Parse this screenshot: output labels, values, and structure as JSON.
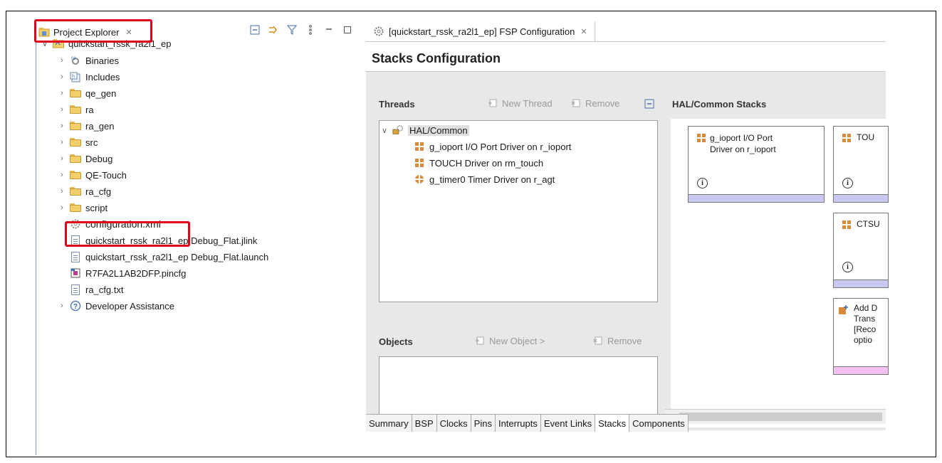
{
  "project_explorer": {
    "title": "Project Explorer",
    "close_glyph": "✕",
    "tree": [
      {
        "label": "quickstart_rssk_ra2l1_ep",
        "icon": "project-icon",
        "expanded": true
      },
      {
        "label": "Binaries",
        "icon": "binaries-icon"
      },
      {
        "label": "Includes",
        "icon": "includes-icon"
      },
      {
        "label": "qe_gen",
        "icon": "source-folder-icon"
      },
      {
        "label": "ra",
        "icon": "source-folder-icon"
      },
      {
        "label": "ra_gen",
        "icon": "source-folder-icon"
      },
      {
        "label": "src",
        "icon": "source-folder-icon"
      },
      {
        "label": "Debug",
        "icon": "folder-icon"
      },
      {
        "label": "QE-Touch",
        "icon": "folder-icon"
      },
      {
        "label": "ra_cfg",
        "icon": "folder-icon"
      },
      {
        "label": "script",
        "icon": "folder-icon"
      },
      {
        "label": "configuration.xml",
        "icon": "gear-file-icon"
      },
      {
        "label": "quickstart_rssk_ra2l1_ep Debug_Flat.jlink",
        "icon": "file-icon"
      },
      {
        "label": "quickstart_rssk_ra2l1_ep Debug_Flat.launch",
        "icon": "file-icon"
      },
      {
        "label": "R7FA2L1AB2DFP.pincfg",
        "icon": "pincfg-icon"
      },
      {
        "label": "ra_cfg.txt",
        "icon": "file-icon"
      },
      {
        "label": "Developer Assistance",
        "icon": "help-icon"
      }
    ]
  },
  "editor": {
    "tab_label": "[quickstart_rssk_ra2l1_ep] FSP Configuration",
    "close_glyph": "✕",
    "title": "Stacks Configuration",
    "threads": {
      "title": "Threads",
      "new_thread": "New Thread",
      "remove": "Remove",
      "root": "HAL/Common",
      "items": [
        "g_ioport I/O Port Driver on r_ioport",
        "TOUCH Driver on rm_touch",
        "g_timer0 Timer Driver on r_agt"
      ]
    },
    "objects": {
      "title": "Objects",
      "new_object": "New Object >",
      "remove": "Remove"
    },
    "hal_stacks": {
      "title": "HAL/Common Stacks",
      "card1_line1": "g_ioport I/O Port",
      "card1_line2": "Driver on r_ioport",
      "card2_label": "TOU",
      "card3_label": "CTSU",
      "card4_line1": "Add D",
      "card4_line2": "Trans",
      "card4_line3": "[Reco",
      "card4_line4": "optio",
      "info_glyph": "i"
    },
    "bottom_tabs": [
      "Summary",
      "BSP",
      "Clocks",
      "Pins",
      "Interrupts",
      "Event Links",
      "Stacks",
      "Components"
    ],
    "active_tab": "Stacks"
  },
  "colors": {
    "highlight_red": "#e0001b",
    "stack_bar": "#c8c8f0",
    "add_bar": "#f4c2f0"
  }
}
